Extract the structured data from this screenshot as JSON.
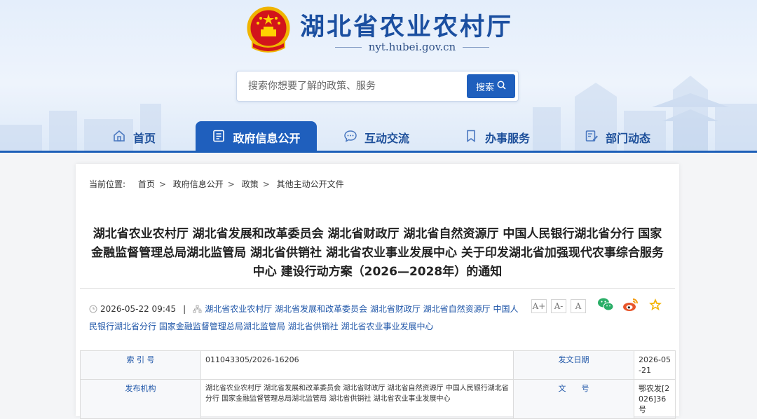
{
  "site": {
    "title": "湖北省农业农村厅",
    "url": "nyt.hubei.gov.cn"
  },
  "search": {
    "placeholder": "搜索你想要了解的政策、服务",
    "button_label": "搜索"
  },
  "nav": [
    {
      "label": "首页",
      "icon": "home-icon"
    },
    {
      "label": "政府信息公开",
      "icon": "document-list-icon",
      "active": true
    },
    {
      "label": "互动交流",
      "icon": "chat-bubble-icon"
    },
    {
      "label": "办事服务",
      "icon": "bookmark-icon"
    },
    {
      "label": "部门动态",
      "icon": "news-edit-icon"
    }
  ],
  "breadcrumb": {
    "prefix": "当前位置:",
    "items": [
      "首页",
      "政府信息公开",
      "政策",
      "其他主动公开文件"
    ]
  },
  "article": {
    "title": "湖北省农业农村厅 湖北省发展和改革委员会 湖北省财政厅 湖北省自然资源厅 中国人民银行湖北省分行 国家金融监督管理总局湖北监管局 湖北省供销社 湖北省农业事业发展中心 关于印发湖北省加强现代农事综合服务中心 建设行动方案（2026—2028年）的通知",
    "date": "2026-05-22 09:45",
    "separator": "|",
    "publishers": "湖北省农业农村厅 湖北省发展和改革委员会 湖北省财政厅 湖北省自然资源厅 中国人民银行湖北省分行 国家金融监督管理总局湖北监管局 湖北省供销社 湖北省农业事业发展中心"
  },
  "font_size_buttons": [
    "A+",
    "A-",
    "A"
  ],
  "share_icons": [
    "wechat-icon",
    "weibo-icon",
    "favorite-star-icon"
  ],
  "colors": {
    "brand_blue": "#1f5fbd",
    "link_blue": "#1f56a8",
    "wechat_green": "#2aae67",
    "weibo_orange": "#e8552a",
    "star_yellow": "#f3b400"
  },
  "info": {
    "index_label": "索 引 号",
    "index_value": "011043305/2026-16206",
    "issue_date_label": "发文日期",
    "issue_date_value": "2026-05-21",
    "agency_label": "发布机构",
    "agency_value": "湖北省农业农村厅 湖北省发展和改革委员会 湖北省财政厅 湖北省自然资源厅 中国人民银行湖北省分行 国家金融监督管理总局湖北监管局 湖北省供销社 湖北省农业事业发展中心",
    "doc_no_label": "文　　号",
    "doc_no_value": "鄂农发[2026]36号"
  }
}
